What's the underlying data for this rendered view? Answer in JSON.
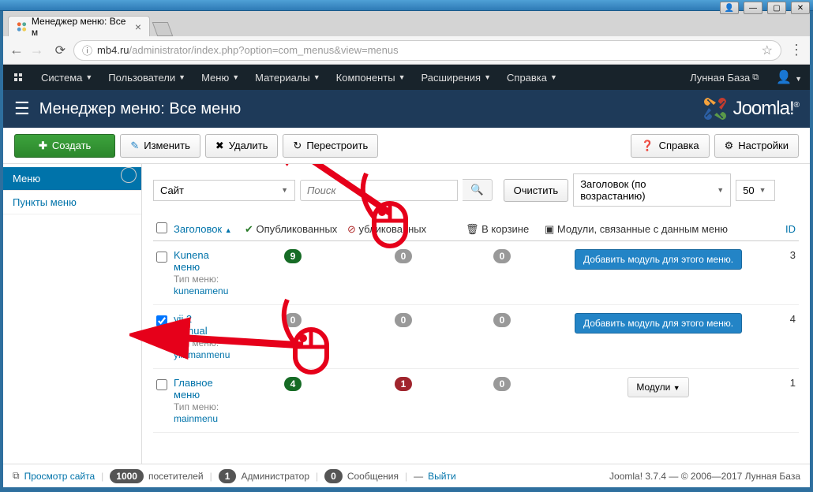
{
  "window": {
    "tab_title": "Менеджер меню: Все м",
    "url_host": "mb4.ru",
    "url_path": "/administrator/index.php?option=com_menus&view=menus"
  },
  "adminbar": {
    "items": [
      "Система",
      "Пользователи",
      "Меню",
      "Материалы",
      "Компоненты",
      "Расширения",
      "Справка"
    ],
    "site_name": "Лунная База"
  },
  "pagetitle": "Менеджер меню: Все меню",
  "brand": "Joomla!",
  "toolbar": {
    "create": "Создать",
    "edit": "Изменить",
    "delete": "Удалить",
    "rebuild": "Перестроить",
    "help": "Справка",
    "options": "Настройки"
  },
  "sidebar": {
    "items": [
      {
        "label": "Меню",
        "active": true
      },
      {
        "label": "Пункты меню",
        "active": false
      }
    ]
  },
  "filters": {
    "client": "Сайт",
    "search_placeholder": "Поиск",
    "clear": "Очистить",
    "sort": "Заголовок (по возрастанию)",
    "limit": "50"
  },
  "columns": {
    "title": "Заголовок",
    "published": "Опубликованных",
    "unpublished": "убликованных",
    "trashed": "В корзине",
    "modules": "Модули, связанные с данным меню",
    "id": "ID"
  },
  "type_label": "Тип меню:",
  "add_module_label": "Добавить модуль для этого меню.",
  "modules_dropdown_label": "Модули",
  "rows": [
    {
      "title_top": "Kunena",
      "title_bottom": "меню",
      "menutype": "kunenamenu",
      "published": "9",
      "unpublished": "0",
      "trashed": "0",
      "has_modules_dropdown": false,
      "id": "3",
      "checked": false
    },
    {
      "title_top": "yii 2",
      "title_bottom": "Manual",
      "menutype": "yii2manmenu",
      "published": "0",
      "unpublished": "0",
      "trashed": "0",
      "has_modules_dropdown": false,
      "id": "4",
      "checked": true
    },
    {
      "title_top": "Главное",
      "title_bottom": "меню",
      "menutype": "mainmenu",
      "published": "4",
      "unpublished": "1",
      "trashed": "0",
      "has_modules_dropdown": true,
      "id": "1",
      "checked": false
    }
  ],
  "footer": {
    "view_site": "Просмотр сайта",
    "visitors_count": "1000",
    "visitors_label": "посетителей",
    "admin_count": "1",
    "admin_label": "Администратор",
    "messages_count": "0",
    "messages_label": "Сообщения",
    "logout": "Выйти",
    "version": "Joomla! 3.7.4  —  © 2006—2017 Лунная База"
  }
}
